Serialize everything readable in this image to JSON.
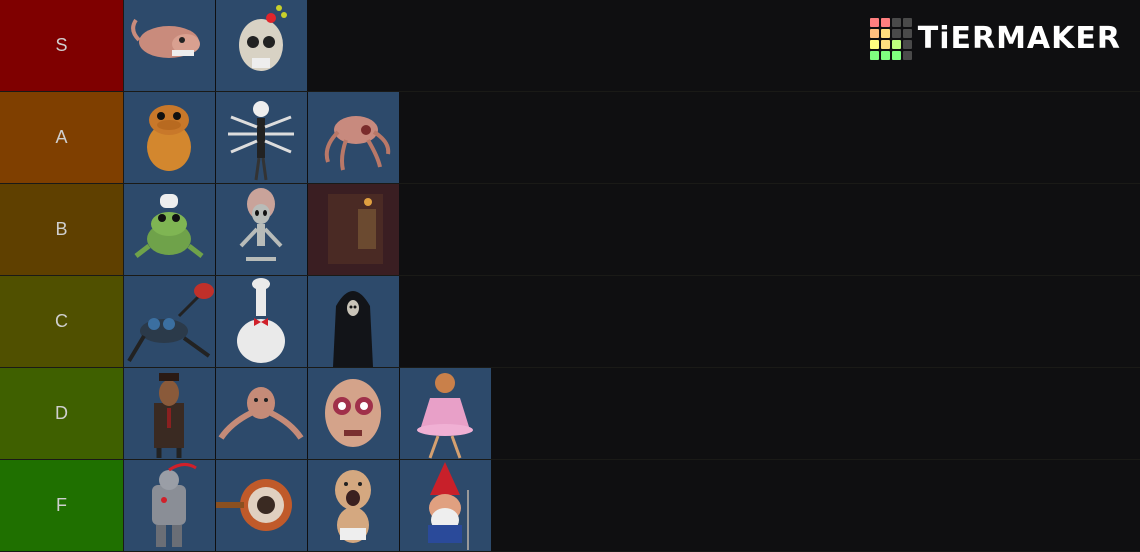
{
  "brand": {
    "text": "TiERMAKER"
  },
  "logo_colors": [
    "#ff7f7f",
    "#ff7f7f",
    "#4a4a4a",
    "#4a4a4a",
    "#ffbf7f",
    "#ffdf7f",
    "#4a4a4a",
    "#4a4a4a",
    "#ffff7f",
    "#ffdf7f",
    "#bfff7f",
    "#4a4a4a",
    "#7fff7f",
    "#7fff7f",
    "#7fff7f",
    "#4a4a4a"
  ],
  "tiers": [
    {
      "label": "S",
      "color": "#7f0000",
      "items": [
        {
          "name": "squid-creature-icon",
          "bg": "#2d4a6b"
        },
        {
          "name": "skull-with-flowers-icon",
          "bg": "#2d4a6b"
        }
      ]
    },
    {
      "label": "A",
      "color": "#7f3f00",
      "items": [
        {
          "name": "orange-duck-creature-icon",
          "bg": "#2d4a6b"
        },
        {
          "name": "white-spider-skeleton-icon",
          "bg": "#2d4a6b"
        },
        {
          "name": "flesh-spider-head-icon",
          "bg": "#2d4a6b"
        }
      ]
    },
    {
      "label": "B",
      "color": "#5f4000",
      "items": [
        {
          "name": "frog-chef-icon",
          "bg": "#2d4a6b"
        },
        {
          "name": "grey-alien-meditating-icon",
          "bg": "#2d4a6b"
        },
        {
          "name": "dark-red-room-icon",
          "bg": "#3a1e22"
        }
      ]
    },
    {
      "label": "C",
      "color": "#505000",
      "items": [
        {
          "name": "mosquito-machine-icon",
          "bg": "#2d4a6b"
        },
        {
          "name": "white-chicken-bowtie-icon",
          "bg": "#2d4a6b"
        },
        {
          "name": "dark-hooded-ghost-icon",
          "bg": "#2d4a6b"
        }
      ]
    },
    {
      "label": "D",
      "color": "#3f6000",
      "items": [
        {
          "name": "old-man-suit-icon",
          "bg": "#2d4a6b"
        },
        {
          "name": "crawling-long-arm-creature-icon",
          "bg": "#2d4a6b"
        },
        {
          "name": "big-bald-face-icon",
          "bg": "#2d4a6b"
        },
        {
          "name": "pink-dress-doll-icon",
          "bg": "#2d4a6b"
        }
      ]
    },
    {
      "label": "F",
      "color": "#1f7000",
      "items": [
        {
          "name": "armored-knight-icon",
          "bg": "#2d4a6b"
        },
        {
          "name": "mechanical-eye-icon",
          "bg": "#2d4a6b"
        },
        {
          "name": "screaming-baby-icon",
          "bg": "#2d4a6b"
        },
        {
          "name": "angry-gnome-icon",
          "bg": "#2d4a6b"
        }
      ]
    }
  ]
}
